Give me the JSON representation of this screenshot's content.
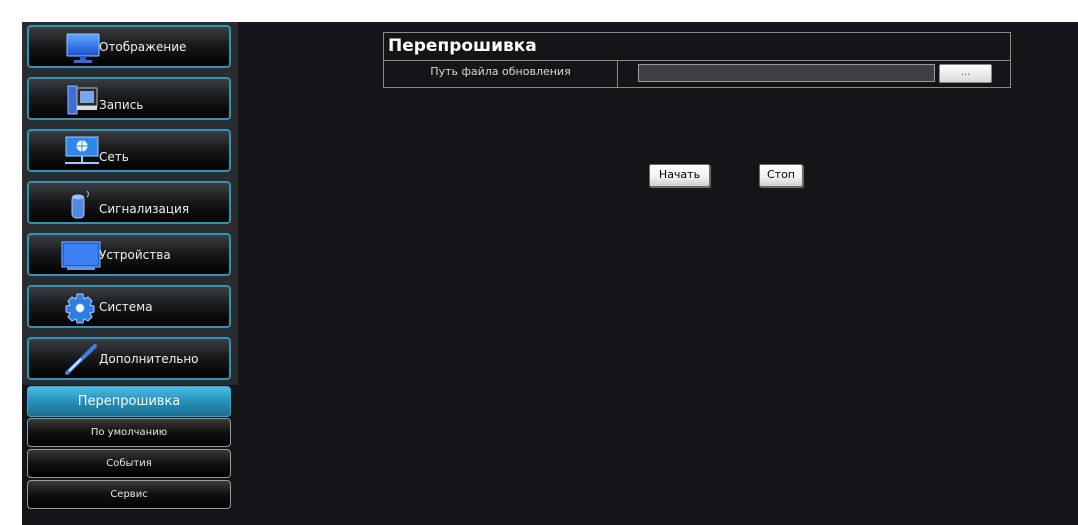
{
  "sidebar": {
    "items": [
      {
        "label": "Отображение",
        "icon": "monitor-icon"
      },
      {
        "label": "Запись",
        "icon": "film-icon"
      },
      {
        "label": "Сеть",
        "icon": "network-globe-icon"
      },
      {
        "label": "Сигнализация",
        "icon": "alarm-icon"
      },
      {
        "label": "Устройства",
        "icon": "devices-monitor-icon"
      },
      {
        "label": "Система",
        "icon": "gear-icon"
      },
      {
        "label": "Дополнительно",
        "icon": "tools-icon"
      }
    ],
    "subitems": [
      {
        "label": "Перепрошивка",
        "active": true
      },
      {
        "label": "По умолчанию"
      },
      {
        "label": "События"
      },
      {
        "label": "Сервис"
      }
    ]
  },
  "panel": {
    "title": "Перепрошивка",
    "path_label": "Путь файла обновления",
    "path_value": "",
    "browse_label": "...",
    "start_label": "Начать",
    "stop_label": "Стоп"
  },
  "colors": {
    "accent": "#2f93b4",
    "active_sub": "#2590b9",
    "background": "#141518"
  }
}
